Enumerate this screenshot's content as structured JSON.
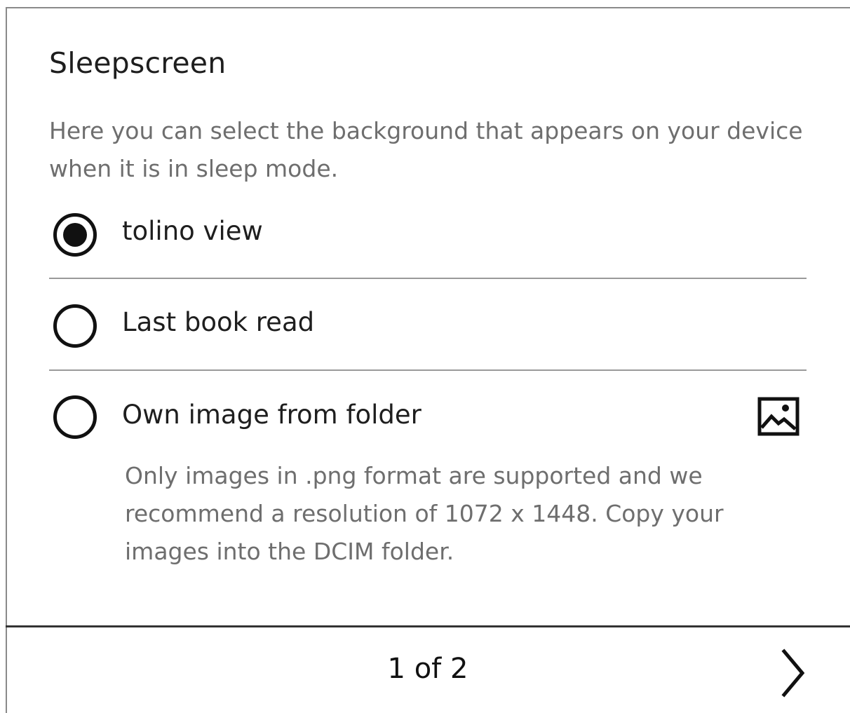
{
  "header": {
    "title": "Sleepscreen"
  },
  "description": "Here you can select the background that appears on your device when it is in sleep mode.",
  "options": [
    {
      "label": "tolino view",
      "selected": true
    },
    {
      "label": "Last book read",
      "selected": false
    },
    {
      "label": "Own image from folder",
      "selected": false,
      "icon": "image-icon"
    }
  ],
  "own_image_note": "Only images in .png format are supported and we recommend a resolution of 1072 x 1448. Copy your images into the DCIM folder.",
  "pagination": {
    "label": "1 of 2",
    "current": 1,
    "total": 2,
    "next_icon": "chevron-right-icon"
  }
}
